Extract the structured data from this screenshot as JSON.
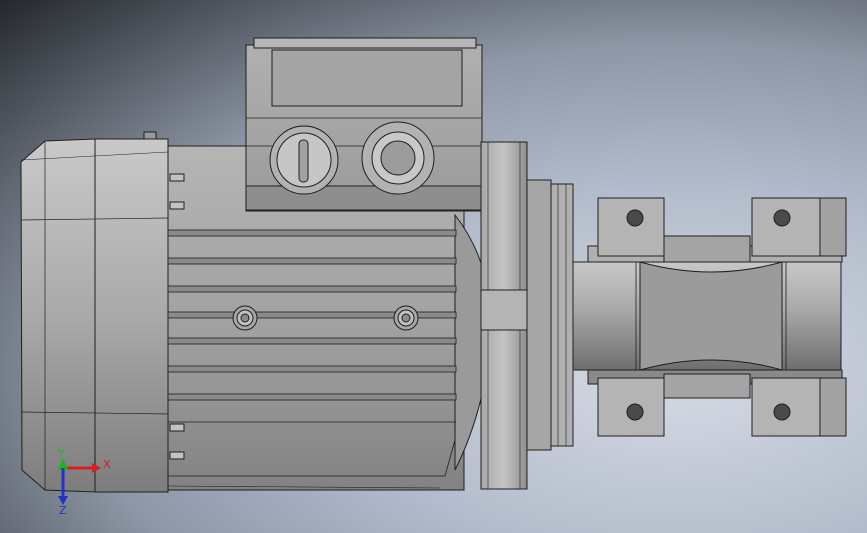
{
  "viewport": {
    "background_colors": [
      "#d6dbe5",
      "#b3bccb",
      "#8e97a6",
      "#4d535c",
      "#24272c"
    ],
    "model_shade_light": "#b8b8b8",
    "model_shade_mid": "#9e9e9e",
    "model_shade_dark": "#6c6c6c",
    "edge_color": "#1f1f1f"
  },
  "triad": {
    "x_label": "X",
    "y_label": "Y",
    "z_label": "Z",
    "x_color": "#d42020",
    "y_color": "#1fb41f",
    "z_color": "#2233cc"
  }
}
